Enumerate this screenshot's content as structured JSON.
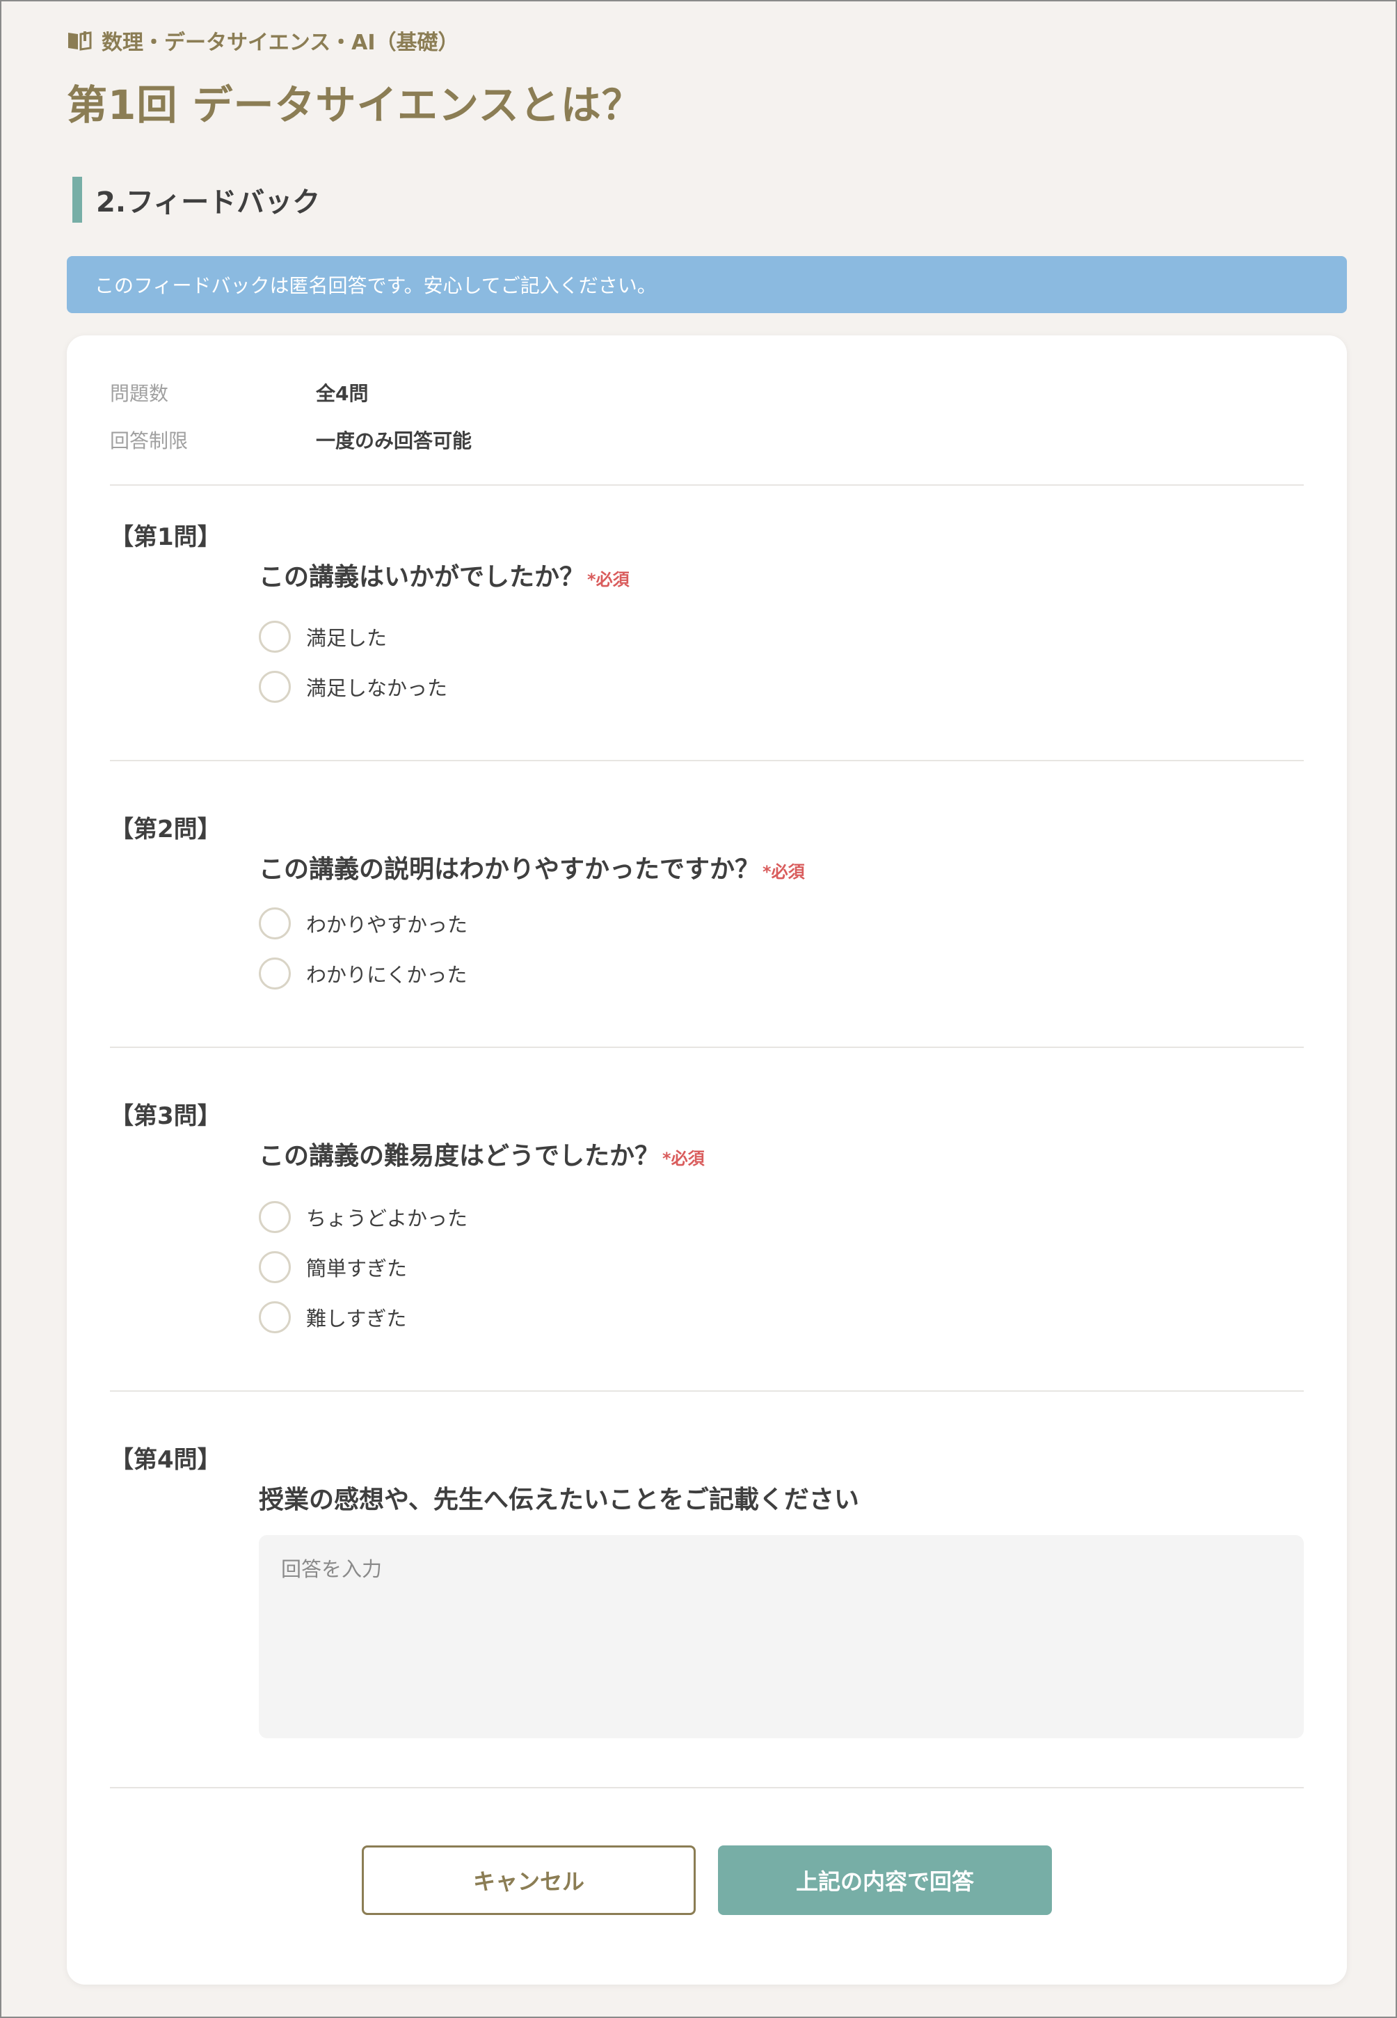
{
  "breadcrumb": {
    "icon": "book-icon",
    "label": "数理・データサイエンス・AI（基礎）"
  },
  "page_title": "第1回 データサイエンスとは？",
  "section_heading": "2.フィードバック",
  "notice": "このフィードバックは匿名回答です。安心してご記入ください。",
  "meta": {
    "count_label": "問題数",
    "count_value": "全4問",
    "limit_label": "回答制限",
    "limit_value": "一度のみ回答可能"
  },
  "required_label": "*必須",
  "questions": [
    {
      "number": "【第1問】",
      "text": "この講義はいかがでしたか？",
      "options": [
        "満足した",
        "満足しなかった"
      ]
    },
    {
      "number": "【第2問】",
      "text": "この講義の説明はわかりやすかったですか？",
      "options": [
        "わかりやすかった",
        "わかりにくかった"
      ]
    },
    {
      "number": "【第3問】",
      "text": "この講義の難易度はどうでしたか？",
      "options": [
        "ちょうどよかった",
        "簡単すぎた",
        "難しすぎた"
      ]
    },
    {
      "number": "【第4問】",
      "text": "授業の感想や、先生へ伝えたいことをご記載ください",
      "placeholder": "回答を入力"
    }
  ],
  "buttons": {
    "cancel": "キャンセル",
    "submit": "上記の内容で回答"
  },
  "colors": {
    "accent": "#8b7d54",
    "teal": "#77aea6",
    "notice_bg": "#8bbae0",
    "required": "#d95c5c",
    "background": "#f5f2ef"
  }
}
